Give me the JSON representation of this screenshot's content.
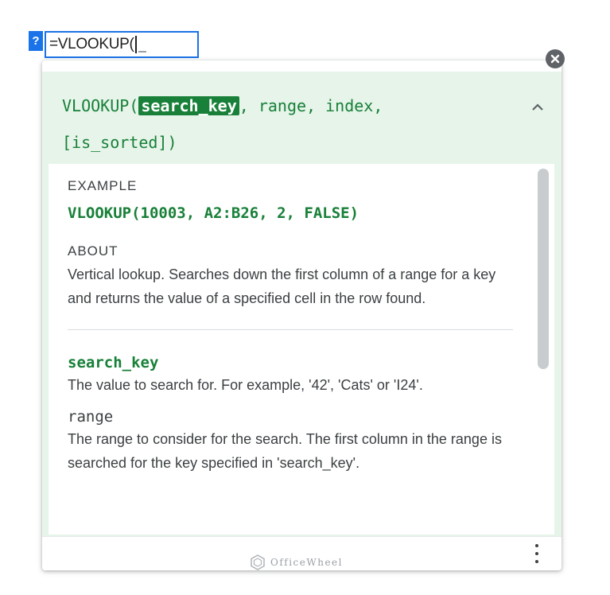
{
  "cell": {
    "help_badge": "?",
    "formula": "=VLOOKUP("
  },
  "signature": {
    "function": "VLOOKUP(",
    "active_param": "search_key",
    "rest_line1": ", range, index,",
    "line2": "[is_sorted])"
  },
  "example": {
    "label": "EXAMPLE",
    "code": "VLOOKUP(10003, A2:B26, 2, FALSE)"
  },
  "about": {
    "label": "ABOUT",
    "text": "Vertical lookup. Searches down the first column of a range for a key and returns the value of a specified cell in the row found."
  },
  "params": [
    {
      "name": "search_key",
      "desc": "The value to search for. For example, '42', 'Cats' or 'I24'."
    },
    {
      "name": "range",
      "desc": "The range to consider for the search. The first column in the range is searched for the key specified in 'search_key'."
    }
  ],
  "watermark": "OfficeWheel",
  "icons": {
    "close": "close-icon",
    "collapse": "chevron-up-icon",
    "more": "more-vert-icon",
    "logo": "officewheel-logo-icon"
  },
  "colors": {
    "accent_blue": "#1a73e8",
    "signature_bg": "#e6f4ea",
    "code_green": "#188038"
  }
}
